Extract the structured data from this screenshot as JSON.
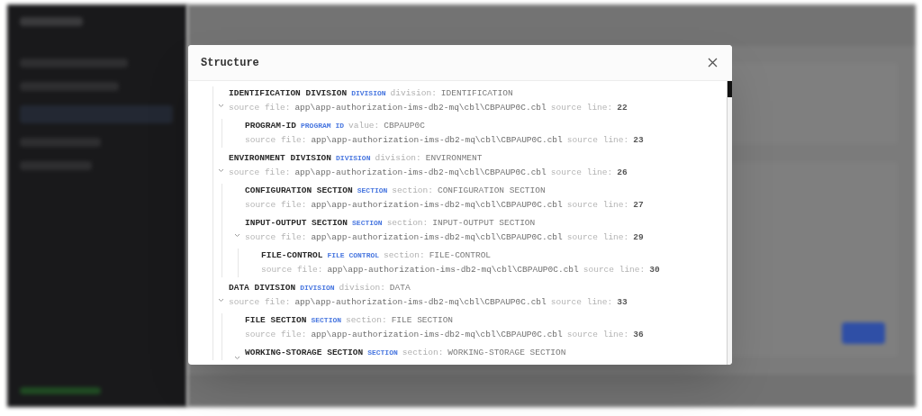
{
  "dialog": {
    "title": "Structure",
    "tree": [
      {
        "name": "IDENTIFICATION DIVISION",
        "type": "DIVISION",
        "attr_label": "division:",
        "attr_value": "IDENTIFICATION",
        "file_label": "source file:",
        "file": "app\\app-authorization-ims-db2-mq\\cbl\\CBPAUP0C.cbl",
        "line_label": "source line:",
        "line": "22",
        "expanded": true,
        "children": [
          {
            "name": "PROGRAM-ID",
            "type": "PROGRAM ID",
            "attr_label": "value:",
            "attr_value": "CBPAUP0C",
            "file_label": "source file:",
            "file": "app\\app-authorization-ims-db2-mq\\cbl\\CBPAUP0C.cbl",
            "line_label": "source line:",
            "line": "23"
          }
        ]
      },
      {
        "name": "ENVIRONMENT DIVISION",
        "type": "DIVISION",
        "attr_label": "division:",
        "attr_value": "ENVIRONMENT",
        "file_label": "source file:",
        "file": "app\\app-authorization-ims-db2-mq\\cbl\\CBPAUP0C.cbl",
        "line_label": "source line:",
        "line": "26",
        "expanded": true,
        "children": [
          {
            "name": "CONFIGURATION SECTION",
            "type": "SECTION",
            "attr_label": "section:",
            "attr_value": "CONFIGURATION SECTION",
            "file_label": "source file:",
            "file": "app\\app-authorization-ims-db2-mq\\cbl\\CBPAUP0C.cbl",
            "line_label": "source line:",
            "line": "27"
          },
          {
            "name": "INPUT-OUTPUT SECTION",
            "type": "SECTION",
            "attr_label": "section:",
            "attr_value": "INPUT-OUTPUT SECTION",
            "file_label": "source file:",
            "file": "app\\app-authorization-ims-db2-mq\\cbl\\CBPAUP0C.cbl",
            "line_label": "source line:",
            "line": "29",
            "expanded": true,
            "children": [
              {
                "name": "FILE-CONTROL",
                "type": "FILE CONTROL",
                "attr_label": "section:",
                "attr_value": "FILE-CONTROL",
                "file_label": "source file:",
                "file": "app\\app-authorization-ims-db2-mq\\cbl\\CBPAUP0C.cbl",
                "line_label": "source line:",
                "line": "30"
              }
            ]
          }
        ]
      },
      {
        "name": "DATA DIVISION",
        "type": "DIVISION",
        "attr_label": "division:",
        "attr_value": "DATA",
        "file_label": "source file:",
        "file": "app\\app-authorization-ims-db2-mq\\cbl\\CBPAUP0C.cbl",
        "line_label": "source line:",
        "line": "33",
        "expanded": true,
        "children": [
          {
            "name": "FILE SECTION",
            "type": "SECTION",
            "attr_label": "section:",
            "attr_value": "FILE SECTION",
            "file_label": "source file:",
            "file": "app\\app-authorization-ims-db2-mq\\cbl\\CBPAUP0C.cbl",
            "line_label": "source line:",
            "line": "36"
          },
          {
            "name": "WORKING-STORAGE SECTION",
            "type": "SECTION",
            "attr_label": "section:",
            "attr_value": "WORKING-STORAGE SECTION",
            "expanded": true
          }
        ]
      }
    ]
  }
}
